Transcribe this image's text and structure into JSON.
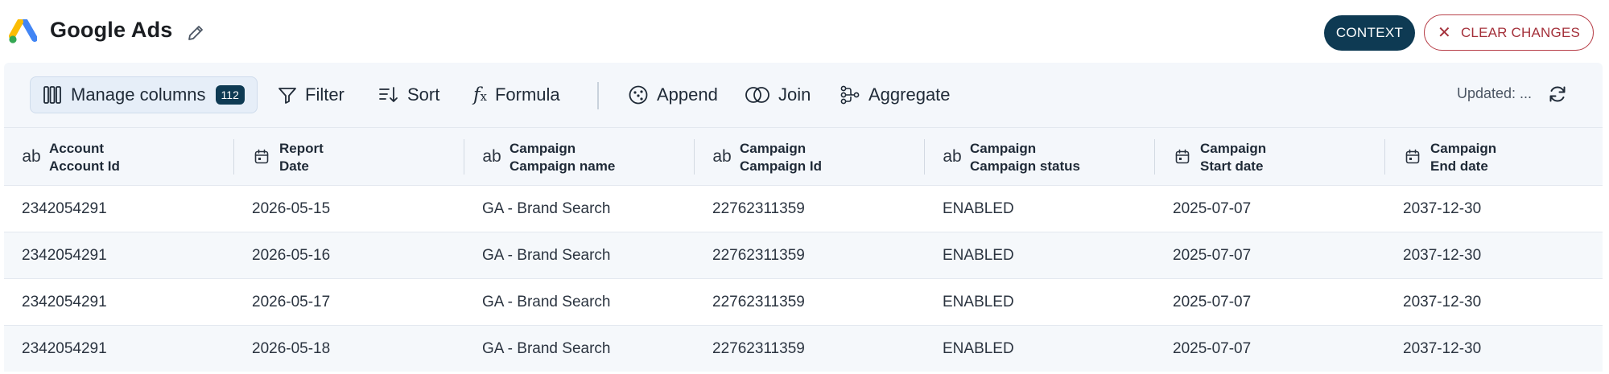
{
  "header": {
    "title": "Google Ads",
    "context_label": "CONTEXT",
    "clear_label": "CLEAR CHANGES"
  },
  "toolbar": {
    "manage_columns": "Manage columns",
    "column_count": "112",
    "filter": "Filter",
    "sort": "Sort",
    "formula": "Formula",
    "append": "Append",
    "join": "Join",
    "aggregate": "Aggregate",
    "updated": "Updated: ..."
  },
  "table": {
    "columns": [
      {
        "line1": "Account",
        "line2": "Account Id",
        "type": "text"
      },
      {
        "line1": "Report",
        "line2": "Date",
        "type": "date"
      },
      {
        "line1": "Campaign",
        "line2": "Campaign name",
        "type": "text"
      },
      {
        "line1": "Campaign",
        "line2": "Campaign Id",
        "type": "text"
      },
      {
        "line1": "Campaign",
        "line2": "Campaign status",
        "type": "text"
      },
      {
        "line1": "Campaign",
        "line2": "Start date",
        "type": "date"
      },
      {
        "line1": "Campaign",
        "line2": "End date",
        "type": "date"
      }
    ],
    "type_icons": {
      "text": "ab"
    },
    "rows": [
      [
        "2342054291",
        "2026-05-15",
        "GA - Brand Search",
        "22762311359",
        "ENABLED",
        "2025-07-07",
        "2037-12-30"
      ],
      [
        "2342054291",
        "2026-05-16",
        "GA - Brand Search",
        "22762311359",
        "ENABLED",
        "2025-07-07",
        "2037-12-30"
      ],
      [
        "2342054291",
        "2026-05-17",
        "GA - Brand Search",
        "22762311359",
        "ENABLED",
        "2025-07-07",
        "2037-12-30"
      ],
      [
        "2342054291",
        "2026-05-18",
        "GA - Brand Search",
        "22762311359",
        "ENABLED",
        "2025-07-07",
        "2037-12-30"
      ]
    ]
  },
  "colors": {
    "accent": "#0e3a53",
    "danger": "#a4303a",
    "panel_bg": "#f4f7fb"
  }
}
